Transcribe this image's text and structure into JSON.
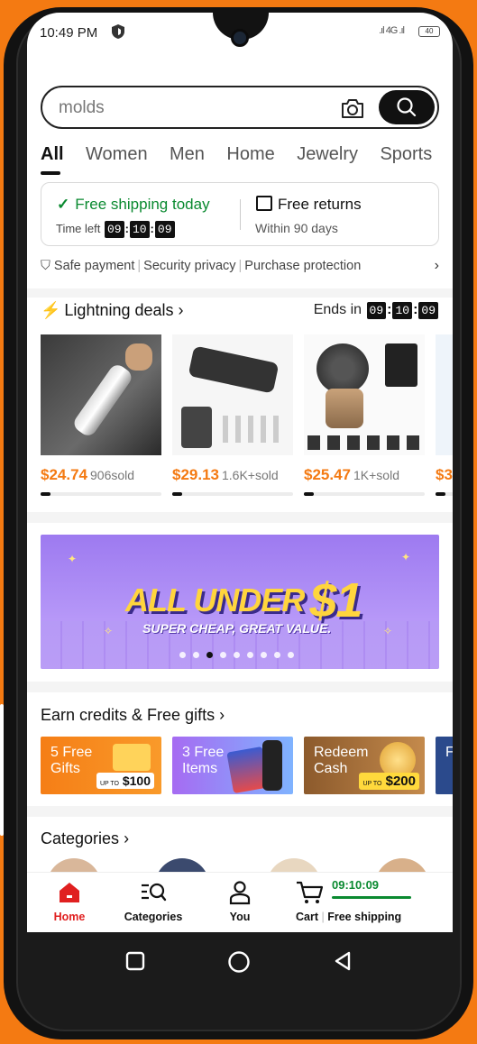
{
  "status": {
    "time": "10:49 PM",
    "signal": "4G",
    "battery": "40"
  },
  "search": {
    "query": "molds",
    "camera_icon": "camera-icon",
    "search_icon": "search-icon"
  },
  "tabs": [
    "All",
    "Women",
    "Men",
    "Home",
    "Jewelry",
    "Sports"
  ],
  "promo": {
    "free_shipping": "Free shipping today",
    "time_left_label": "Time left",
    "timer": [
      "09",
      "10",
      "09"
    ],
    "free_returns": "Free returns",
    "returns_days": "Within 90 days"
  },
  "trust": [
    "Safe payment",
    "Security privacy",
    "Purchase protection"
  ],
  "lightning": {
    "title": "Lightning deals",
    "ends_label": "Ends in",
    "timer": [
      "09",
      "10",
      "09"
    ],
    "deals": [
      {
        "price": "$24.74",
        "sold": "906sold"
      },
      {
        "price": "$29.13",
        "sold": "1.6K+sold"
      },
      {
        "price": "$25.47",
        "sold": "1K+sold"
      },
      {
        "price": "$3",
        "sold": ""
      }
    ]
  },
  "banner": {
    "headline": "ALL UNDER",
    "amount": "$1",
    "subline": "SUPER CHEAP, GREAT VALUE.",
    "slides": 9,
    "active_slide": 3
  },
  "earn": {
    "title": "Earn credits & Free gifts",
    "cards": [
      {
        "label": "5 Free Gifts",
        "amount": "$100",
        "amount_prefix": "UP TO"
      },
      {
        "label": "3 Free Items",
        "amount": "",
        "amount_prefix": ""
      },
      {
        "label": "Redeem Cash",
        "amount": "$200",
        "amount_prefix": "UP TO"
      },
      {
        "label": "F",
        "amount": "",
        "amount_prefix": ""
      }
    ]
  },
  "categories": {
    "title": "Categories"
  },
  "nav": {
    "home": "Home",
    "categories": "Categories",
    "you": "You",
    "cart": "Cart",
    "cart_shipping": "Free shipping",
    "cart_timer": "09:10:09"
  },
  "colors": {
    "accent": "#f47a12",
    "green": "#0a8a30",
    "home_red": "#e02020"
  }
}
